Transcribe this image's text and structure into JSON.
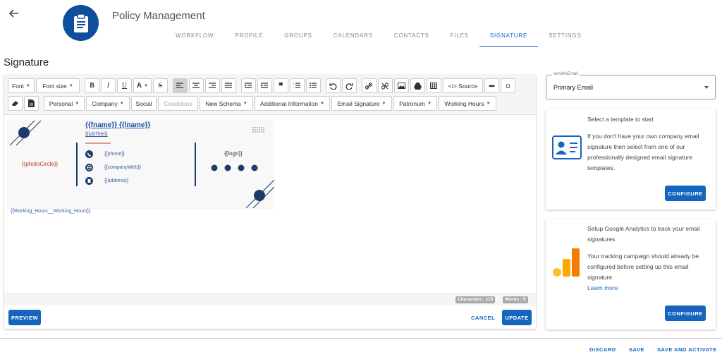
{
  "header": {
    "app_title": "Policy Management",
    "tabs": [
      {
        "label": "WORKFLOW",
        "active": false
      },
      {
        "label": "PROFILE",
        "active": false
      },
      {
        "label": "GROUPS",
        "active": false
      },
      {
        "label": "CALENDARS",
        "active": false
      },
      {
        "label": "CONTACTS",
        "active": false
      },
      {
        "label": "FILES",
        "active": false
      },
      {
        "label": "SIGNATURE",
        "active": true
      },
      {
        "label": "SETTINGS",
        "active": false
      }
    ]
  },
  "page": {
    "title": "Signature"
  },
  "toolbar": {
    "font": "Font",
    "font_size": "Font size",
    "bold": "B",
    "italic": "I",
    "underline": "U",
    "font_color": "A",
    "strike": "S",
    "source": "</> Source",
    "omega": "Ω",
    "personal": "Personal",
    "company": "Company",
    "social": "Social",
    "conditions": "Conditions",
    "new_schema": "New Schema",
    "additional_info": "Additional Information",
    "email_signature": "Email Signature",
    "patronum": "Patronum",
    "working_hours": "Working Hours"
  },
  "signature": {
    "fname": "{{fname}}",
    "lname": "{{lname}}",
    "job_title": "{{jobTitle}}",
    "photo": "{{photoCircle}}",
    "phone": "{{phone}}",
    "company_web": "{{companyWeb}}",
    "address": "{{address}}",
    "logo": "{{logo}}",
    "working_hours": "{{Working_Hours__Working_Hours}}"
  },
  "status": {
    "characters": "Characters : 119",
    "words": "Words : 9"
  },
  "editor_actions": {
    "preview": "PREVIEW",
    "cancel": "CANCEL",
    "update": "UPDATE"
  },
  "send_as": {
    "label": "sendAsEmail",
    "value": "Primary Email"
  },
  "template_card": {
    "heading": "Select a template to start",
    "body": "If you don't have your own company email signature then select from one of our professionally designed email signature templates.",
    "button": "CONFIGURE"
  },
  "analytics_card": {
    "heading": "Setup Google Analytics to track your email signatures",
    "body": "Your tracking campaign should already be configured before setting up this email signature.",
    "link": "Learn more",
    "button": "CONFIGURE"
  },
  "footer": {
    "discard": "DISCARD",
    "save": "SAVE",
    "save_activate": "SAVE AND ACTIVATE"
  },
  "colors": {
    "primary": "#1565c0",
    "logo_bg": "#0d4f9c",
    "signature_dark": "#1f3a66",
    "analytics_orange": "#f9ab00"
  }
}
